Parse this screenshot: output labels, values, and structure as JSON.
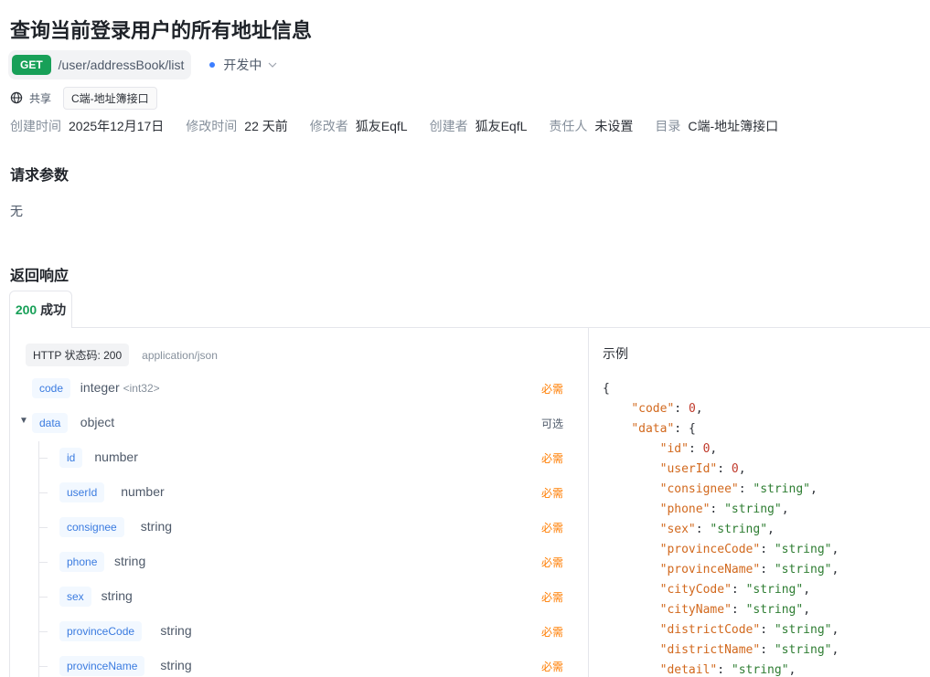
{
  "page_title": "查询当前登录用户的所有地址信息",
  "method": "GET",
  "path": "/user/addressBook/list",
  "status": "开发中",
  "share_label": "共享",
  "folder_tag": "C端-地址簿接口",
  "meta": [
    {
      "k": "创建时间",
      "v": "2025年12月17日"
    },
    {
      "k": "修改时间",
      "v": "22 天前"
    },
    {
      "k": "修改者",
      "v": "狐友EqfL"
    },
    {
      "k": "创建者",
      "v": "狐友EqfL"
    },
    {
      "k": "责任人",
      "v": "未设置"
    },
    {
      "k": "目录",
      "v": "C端-地址簿接口"
    }
  ],
  "request_params_title": "请求参数",
  "request_params_none": "无",
  "response_title": "返回响应",
  "response_tab": {
    "code": "200",
    "label": "成功"
  },
  "http_status_tag": "HTTP 状态码: 200",
  "content_type": "application/json",
  "example_title": "示例",
  "fields": [
    {
      "name": "code",
      "type": "integer",
      "format": "<int32>",
      "flag": "必需",
      "required": true,
      "level": 0
    },
    {
      "name": "data",
      "type": "object",
      "format": "",
      "flag": "可选",
      "required": false,
      "level": 0,
      "expandable": true
    },
    {
      "name": "id",
      "type": "number",
      "format": "",
      "flag": "必需",
      "required": true,
      "level": 1
    },
    {
      "name": "userId",
      "type": "number",
      "format": "",
      "flag": "必需",
      "required": true,
      "level": 1
    },
    {
      "name": "consignee",
      "type": "string",
      "format": "",
      "flag": "必需",
      "required": true,
      "level": 1
    },
    {
      "name": "phone",
      "type": "string",
      "format": "",
      "flag": "必需",
      "required": true,
      "level": 1
    },
    {
      "name": "sex",
      "type": "string",
      "format": "",
      "flag": "必需",
      "required": true,
      "level": 1
    },
    {
      "name": "provinceCode",
      "type": "string",
      "format": "",
      "flag": "必需",
      "required": true,
      "level": 1
    },
    {
      "name": "provinceName",
      "type": "string",
      "format": "",
      "flag": "必需",
      "required": true,
      "level": 1
    }
  ],
  "example_lines": [
    {
      "indent": 0,
      "text": "{"
    },
    {
      "indent": 1,
      "key": "code",
      "num": "0"
    },
    {
      "indent": 1,
      "key": "data",
      "open": "{"
    },
    {
      "indent": 2,
      "key": "id",
      "num": "0"
    },
    {
      "indent": 2,
      "key": "userId",
      "num": "0"
    },
    {
      "indent": 2,
      "key": "consignee",
      "str": "string"
    },
    {
      "indent": 2,
      "key": "phone",
      "str": "string"
    },
    {
      "indent": 2,
      "key": "sex",
      "str": "string"
    },
    {
      "indent": 2,
      "key": "provinceCode",
      "str": "string"
    },
    {
      "indent": 2,
      "key": "provinceName",
      "str": "string"
    },
    {
      "indent": 2,
      "key": "cityCode",
      "str": "string"
    },
    {
      "indent": 2,
      "key": "cityName",
      "str": "string"
    },
    {
      "indent": 2,
      "key": "districtCode",
      "str": "string"
    },
    {
      "indent": 2,
      "key": "districtName",
      "str": "string"
    },
    {
      "indent": 2,
      "key": "detail",
      "str": "string"
    }
  ],
  "colors": {
    "get": "#18a058",
    "required": "#ff7d00",
    "status_dot": "#3c7eff",
    "field_name": "#3a7be0"
  },
  "icons": {
    "share": "globe-icon",
    "status_dropdown": "chevron-down-icon",
    "expand": "caret-down-icon"
  }
}
